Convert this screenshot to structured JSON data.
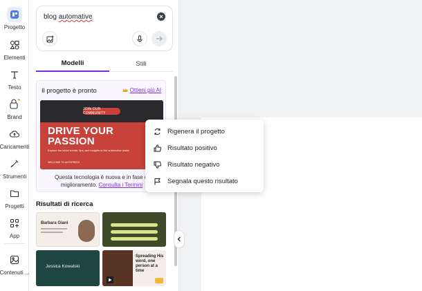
{
  "rail": {
    "items": [
      {
        "label": "Progetto",
        "icon": "canva-project-icon",
        "active": true
      },
      {
        "label": "Elementi",
        "icon": "shapes-icon"
      },
      {
        "label": "Testo",
        "icon": "text-icon"
      },
      {
        "label": "Brand",
        "icon": "brand-icon"
      },
      {
        "label": "Caricamenti",
        "icon": "upload-icon"
      },
      {
        "label": "Strumenti",
        "icon": "tools-icon"
      },
      {
        "label": "Progetti",
        "icon": "folder-icon"
      },
      {
        "label": "App",
        "icon": "apps-icon"
      },
      {
        "label": "Contenuti ...",
        "icon": "photos-icon"
      }
    ]
  },
  "prompt": {
    "word1": "blog",
    "word2": "automative"
  },
  "tabs": {
    "models": "Modelli",
    "styles": "Stili"
  },
  "result": {
    "title": "Il progetto è pronto",
    "more_ai": "Ottieni più AI",
    "preview": {
      "pill": "JOIN OUR COMMUNITY",
      "headline_1": "DRIVE YOUR",
      "headline_2": "PASSION",
      "subtitle": "Explore the latest trends, tips, and insights in the automotive world",
      "footer": "WELCOME TO AUTOPRESS"
    },
    "desc": "Questa tecnologia è nuova e in fase di",
    "desc2": "miglioramento.",
    "terms_link": "Consulta i Termini"
  },
  "search_results": {
    "title": "Risultati di ricerca",
    "items": [
      {
        "name": "Barbara Giani"
      },
      {
        "name": "green-event"
      },
      {
        "name": "Jessica Kowalski"
      },
      {
        "name": "Spreading His word, one person at a time"
      }
    ]
  },
  "menu": {
    "items": [
      {
        "label": "Rigenera il progetto",
        "icon": "regenerate-icon"
      },
      {
        "label": "Risultato positivo",
        "icon": "thumbs-up-icon"
      },
      {
        "label": "Risultato negativo",
        "icon": "thumbs-down-icon"
      },
      {
        "label": "Segnala questo risultato",
        "icon": "flag-icon"
      }
    ]
  },
  "colors": {
    "accent": "#7d2ae8",
    "preview_red": "#c6423b"
  }
}
